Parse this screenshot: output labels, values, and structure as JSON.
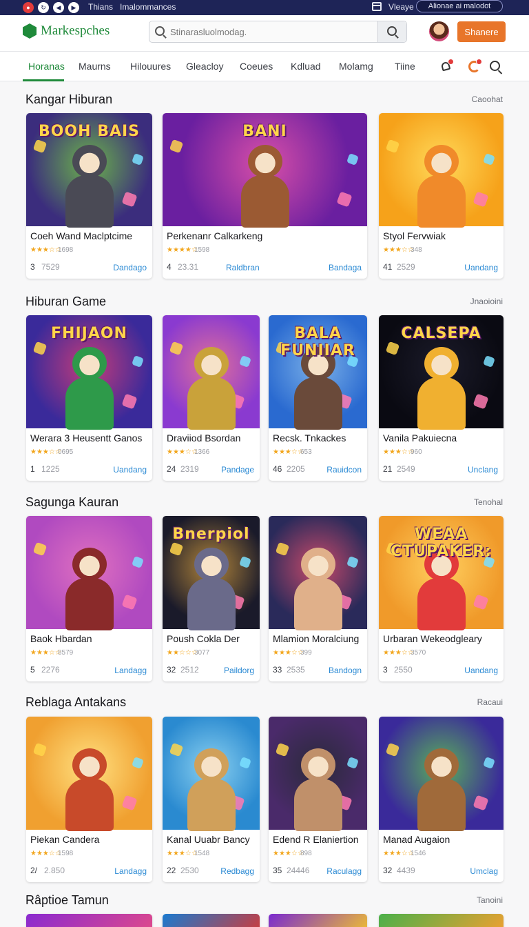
{
  "topbar": {
    "title1": "Thians",
    "title2": "Imalommances",
    "window_label": "Vleaye",
    "pill_text": "Alionae ai malodot"
  },
  "header": {
    "logo": "Markespches",
    "search_placeholder": "Stinarasluolmodag.",
    "cta": "Shanere"
  },
  "nav": {
    "tabs": [
      "Horanas",
      "Maurns",
      "Hilouures",
      "Gleacloy",
      "Coeues",
      "Kdluad",
      "Molamg",
      "Tiine"
    ]
  },
  "sections": [
    {
      "title": "Kangar Hiburan",
      "link": "Caoohat",
      "cards": [
        {
          "name": "Coeh Wand Maclptcime",
          "stars": "★★★☆☆",
          "rating": "1698",
          "num": "3",
          "count": "7529",
          "mid": "",
          "link": "Dandago",
          "art_title": "BOOH BAIS",
          "colors": [
            "#3b2d7d",
            "#6bb34a",
            "#4a4a55"
          ]
        },
        {
          "name": "Perkenanr Calkarkeng",
          "stars": "★★★★☆",
          "rating": "1598",
          "num": "4",
          "count": "23.31",
          "mid": "Raldbran",
          "link": "Bandaga",
          "art_title": "BANI",
          "colors": [
            "#6a1fa0",
            "#d84fa8",
            "#9b5a33"
          ]
        },
        {
          "name": "Styol Fervwiak",
          "stars": "★★★☆☆",
          "rating": "348",
          "num": "41",
          "count": "2529",
          "mid": "",
          "link": "Uandang",
          "art_title": "",
          "colors": [
            "#f6a21a",
            "#ffd95a",
            "#f08a2a"
          ]
        }
      ]
    },
    {
      "title": "Hiburan Game",
      "link": "Jnaoioini",
      "cards": [
        {
          "name": "Werara 3 Heusentt Ganos",
          "stars": "★★★☆☆",
          "rating": "0695",
          "num": "1",
          "count": "1225",
          "mid": "",
          "link": "Uandang",
          "art_title": "FHIJAON",
          "colors": [
            "#3a2a9a",
            "#c43c7a",
            "#2e9a4a"
          ]
        },
        {
          "name": "Draviiod Bsordan",
          "stars": "★★★☆☆",
          "rating": "1366",
          "num": "24",
          "count": "2319",
          "mid": "",
          "link": "Pandage",
          "art_title": "",
          "colors": [
            "#8a3ad0",
            "#e0709a",
            "#c9a23a"
          ]
        },
        {
          "name": "Recsk. Tnkackes",
          "stars": "★★★☆☆",
          "rating": "653",
          "num": "46",
          "count": "2205",
          "mid": "",
          "link": "Rauidcon",
          "art_title": "BALA FUNIIAR",
          "colors": [
            "#2a6ad0",
            "#7ab0e8",
            "#6a4a3a"
          ]
        },
        {
          "name": "Vanila Pakuiecna",
          "stars": "★★★☆☆",
          "rating": "960",
          "num": "21",
          "count": "2549",
          "mid": "",
          "link": "Unclang",
          "art_title": "CALSEPA",
          "colors": [
            "#0a0a12",
            "#1b1b2a",
            "#f0b030"
          ]
        }
      ]
    },
    {
      "title": "Sagunga Kauran",
      "link": "Tenohal",
      "cards": [
        {
          "name": "Baok Hbardan",
          "stars": "★★★☆☆",
          "rating": "8579",
          "num": "5",
          "count": "2276",
          "mid": "",
          "link": "Landagg",
          "art_title": "",
          "colors": [
            "#b04ac0",
            "#e070c0",
            "#8a2a2a"
          ]
        },
        {
          "name": "Poush Cokla Der",
          "stars": "★★☆☆☆",
          "rating": "3077",
          "num": "32",
          "count": "2512",
          "mid": "",
          "link": "Paildorg",
          "art_title": "Bnerpiol",
          "colors": [
            "#1a1a2a",
            "#b0843a",
            "#6a6a8a"
          ]
        },
        {
          "name": "Mlamion Moralciung",
          "stars": "★★★☆☆",
          "rating": "399",
          "num": "33",
          "count": "2535",
          "mid": "",
          "link": "Bandogn",
          "art_title": "",
          "colors": [
            "#2a2a5a",
            "#c84a6a",
            "#e0b08a"
          ]
        },
        {
          "name": "Urbaran Wekeodgleary",
          "stars": "★★★☆☆",
          "rating": "3570",
          "num": "3",
          "count": "2550",
          "mid": "",
          "link": "Uandang",
          "art_title": "WEAA CTUPAKER:",
          "colors": [
            "#f09a2a",
            "#ffd060",
            "#e23b3b"
          ]
        }
      ]
    },
    {
      "title": "Reblaga Antakans",
      "link": "Racaui",
      "cards": [
        {
          "name": "Piekan Candera",
          "stars": "★★★☆☆",
          "rating": "1598",
          "num": "2/",
          "count": "2.850",
          "mid": "",
          "link": "Landagg",
          "art_title": "",
          "colors": [
            "#f0a030",
            "#ffe080",
            "#c84a2a"
          ]
        },
        {
          "name": "Kanal Uuabr Bancy",
          "stars": "★★★☆☆",
          "rating": "1548",
          "num": "22",
          "count": "2530",
          "mid": "",
          "link": "Redbagg",
          "art_title": "",
          "colors": [
            "#2a8ad0",
            "#8ad0f0",
            "#d0a05a"
          ]
        },
        {
          "name": "Edend R Elaniertion",
          "stars": "★★★☆☆",
          "rating": "898",
          "num": "35",
          "count": "24446",
          "mid": "",
          "link": "Raculagg",
          "art_title": "",
          "colors": [
            "#4a2a6a",
            "#2a2a3a",
            "#c0906a"
          ]
        },
        {
          "name": "Manad Augaion",
          "stars": "★★★☆☆",
          "rating": "1546",
          "num": "32",
          "count": "4439",
          "mid": "",
          "link": "Umclag",
          "art_title": "",
          "colors": [
            "#3a2a9a",
            "#5ab05a",
            "#a06a3a"
          ]
        }
      ]
    },
    {
      "title": "Râptioe Tamun",
      "link": "Tanoini",
      "cards": []
    }
  ]
}
